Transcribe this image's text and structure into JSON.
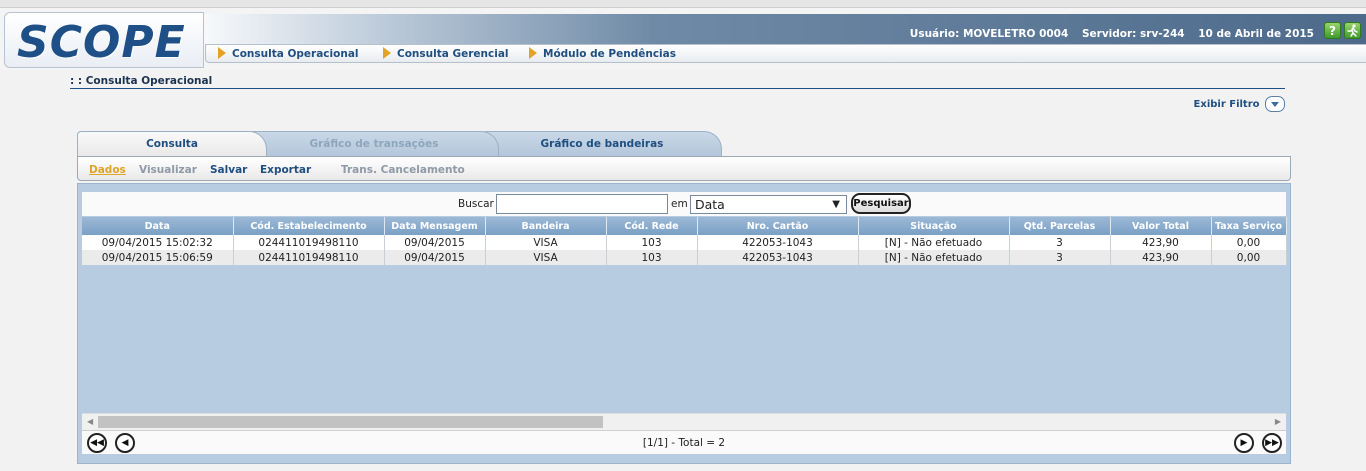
{
  "app": {
    "logo": "SCOPE"
  },
  "header": {
    "user": "Usuário: MOVELETRO 0004",
    "server": "Servidor: srv-244",
    "date": "10 de Abril de 2015",
    "help_glyph": "?",
    "help_icon": "help-icon",
    "exit_icon": "exit-icon"
  },
  "menu": [
    {
      "label": "Consulta Operacional"
    },
    {
      "label": "Consulta Gerencial"
    },
    {
      "label": "Módulo de Pendências"
    }
  ],
  "breadcrumb": ": : Consulta Operacional",
  "filter_toggle": "Exibir Filtro",
  "tabs": [
    {
      "label": "Consulta",
      "active": true
    },
    {
      "label": "Gráfico de transações",
      "enabled": false
    },
    {
      "label": "Gráfico de bandeiras",
      "enabled": true
    }
  ],
  "subtabs": [
    {
      "label": "Dados",
      "active": true,
      "color": "#e0a32a"
    },
    {
      "label": "Visualizar",
      "enabled": false,
      "color": "#8f9aa6"
    },
    {
      "label": "Salvar",
      "enabled": true,
      "color": "#1f4e80"
    },
    {
      "label": "Exportar",
      "enabled": true,
      "color": "#1f4e80"
    },
    {
      "label": "Trans. Cancelamento",
      "enabled": false,
      "color": "#8f9aa6"
    }
  ],
  "search": {
    "label": "Buscar",
    "value": "",
    "in_label": "em",
    "field_selected": "Data",
    "button": "Pesquisar"
  },
  "table": {
    "columns": [
      "Data",
      "Cód. Estabelecimento",
      "Data Mensagem",
      "Bandeira",
      "Cód. Rede",
      "Nro. Cartão",
      "Situação",
      "Qtd. Parcelas",
      "Valor Total",
      "Taxa Serviço"
    ],
    "rows": [
      [
        "09/04/2015 15:02:32",
        "024411019498110",
        "09/04/2015",
        "VISA",
        "103",
        "422053-1043",
        "[N] - Não efetuado",
        "3",
        "423,90",
        "0,00"
      ],
      [
        "09/04/2015 15:06:59",
        "024411019498110",
        "09/04/2015",
        "VISA",
        "103",
        "422053-1043",
        "[N] - Não efetuado",
        "3",
        "423,90",
        "0,00"
      ]
    ]
  },
  "pager": {
    "text": "[1/1] - Total = 2"
  },
  "colors": {
    "brand": "#1e4f86",
    "accent": "#e2a326",
    "panel": "#b7cce1"
  }
}
